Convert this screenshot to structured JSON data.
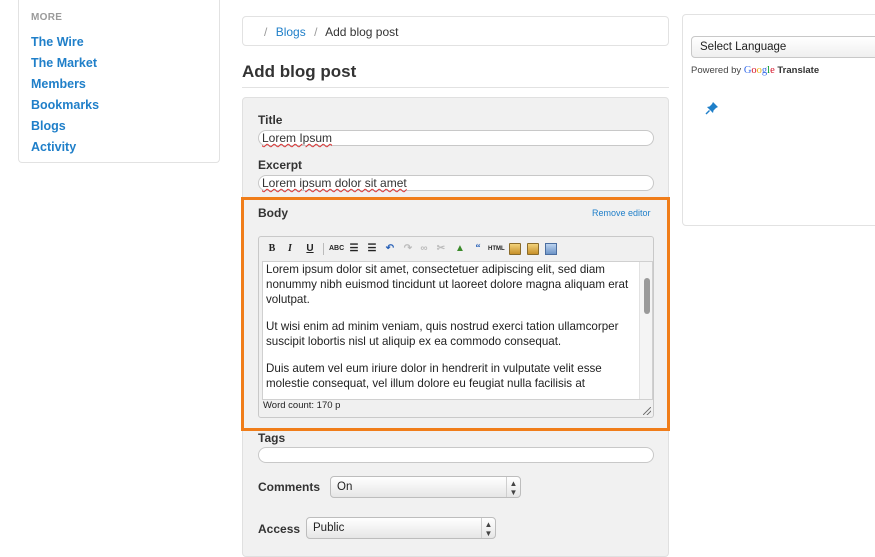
{
  "sidebar": {
    "section_title": "MORE",
    "items": [
      {
        "label": "The Wire"
      },
      {
        "label": "The Market"
      },
      {
        "label": "Members"
      },
      {
        "label": "Bookmarks"
      },
      {
        "label": "Blogs"
      },
      {
        "label": "Activity"
      }
    ]
  },
  "breadcrumb": {
    "separator": "/",
    "items": [
      {
        "label": "Blogs"
      },
      {
        "label": "Add blog post"
      }
    ]
  },
  "page": {
    "title": "Add blog post"
  },
  "form": {
    "title_label": "Title",
    "title_value": "Lorem Ipsum",
    "excerpt_label": "Excerpt",
    "excerpt_value": "Lorem ipsum dolor sit amet",
    "body_label": "Body",
    "remove_editor": "Remove editor",
    "toolbar": {
      "icons": [
        "bold-icon",
        "italic-icon",
        "underline-icon",
        "spellcheck-icon",
        "bullet-list-icon",
        "numbered-list-icon",
        "undo-icon",
        "redo-icon",
        "link-icon",
        "unlink-icon",
        "image-icon",
        "blockquote-icon",
        "html-icon",
        "paste-text-icon",
        "paste-word-icon",
        "fullscreen-icon"
      ]
    },
    "body_paragraphs": [
      "Lorem ipsum dolor sit amet, consectetuer adipiscing elit, sed diam nonummy nibh euismod tincidunt ut laoreet dolore magna aliquam erat volutpat.",
      "Ut wisi enim ad minim veniam, quis nostrud exerci tation ullamcorper suscipit lobortis nisl ut aliquip ex ea commodo consequat.",
      "Duis autem vel eum iriure dolor in hendrerit in vulputate velit esse molestie consequat, vel illum dolore eu feugiat nulla facilisis at"
    ],
    "word_count": "Word count: 170 p",
    "tags_label": "Tags",
    "tags_value": "",
    "comments_label": "Comments",
    "comments_value": "On",
    "access_label": "Access",
    "access_value": "Public"
  },
  "translate": {
    "select_label": "Select Language",
    "powered_by": "Powered by",
    "google": "Google",
    "translate_word": "Translate"
  },
  "colors": {
    "link": "#1f7fc9",
    "highlight": "#f07d1a"
  }
}
